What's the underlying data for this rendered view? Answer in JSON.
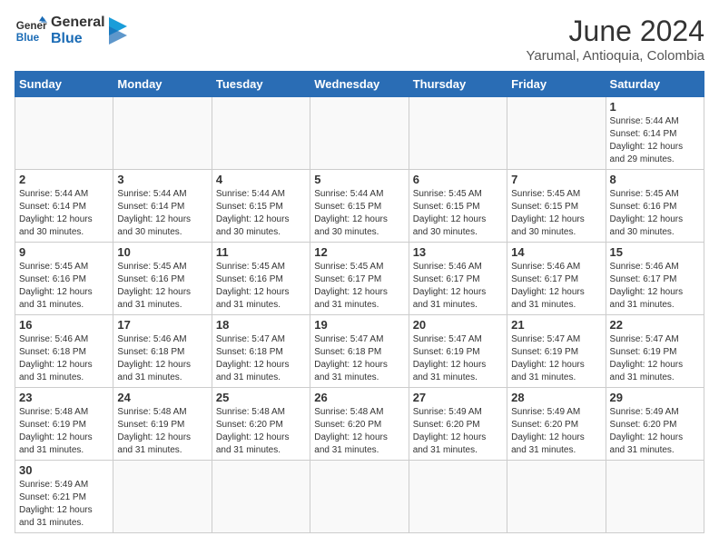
{
  "logo": {
    "text_general": "General",
    "text_blue": "Blue"
  },
  "header": {
    "title": "June 2024",
    "subtitle": "Yarumal, Antioquia, Colombia"
  },
  "weekdays": [
    "Sunday",
    "Monday",
    "Tuesday",
    "Wednesday",
    "Thursday",
    "Friday",
    "Saturday"
  ],
  "weeks": [
    [
      {
        "day": "",
        "info": ""
      },
      {
        "day": "",
        "info": ""
      },
      {
        "day": "",
        "info": ""
      },
      {
        "day": "",
        "info": ""
      },
      {
        "day": "",
        "info": ""
      },
      {
        "day": "",
        "info": ""
      },
      {
        "day": "1",
        "info": "Sunrise: 5:44 AM\nSunset: 6:14 PM\nDaylight: 12 hours\nand 29 minutes."
      }
    ],
    [
      {
        "day": "2",
        "info": "Sunrise: 5:44 AM\nSunset: 6:14 PM\nDaylight: 12 hours\nand 30 minutes."
      },
      {
        "day": "3",
        "info": "Sunrise: 5:44 AM\nSunset: 6:14 PM\nDaylight: 12 hours\nand 30 minutes."
      },
      {
        "day": "4",
        "info": "Sunrise: 5:44 AM\nSunset: 6:15 PM\nDaylight: 12 hours\nand 30 minutes."
      },
      {
        "day": "5",
        "info": "Sunrise: 5:44 AM\nSunset: 6:15 PM\nDaylight: 12 hours\nand 30 minutes."
      },
      {
        "day": "6",
        "info": "Sunrise: 5:45 AM\nSunset: 6:15 PM\nDaylight: 12 hours\nand 30 minutes."
      },
      {
        "day": "7",
        "info": "Sunrise: 5:45 AM\nSunset: 6:15 PM\nDaylight: 12 hours\nand 30 minutes."
      },
      {
        "day": "8",
        "info": "Sunrise: 5:45 AM\nSunset: 6:16 PM\nDaylight: 12 hours\nand 30 minutes."
      }
    ],
    [
      {
        "day": "9",
        "info": "Sunrise: 5:45 AM\nSunset: 6:16 PM\nDaylight: 12 hours\nand 31 minutes."
      },
      {
        "day": "10",
        "info": "Sunrise: 5:45 AM\nSunset: 6:16 PM\nDaylight: 12 hours\nand 31 minutes."
      },
      {
        "day": "11",
        "info": "Sunrise: 5:45 AM\nSunset: 6:16 PM\nDaylight: 12 hours\nand 31 minutes."
      },
      {
        "day": "12",
        "info": "Sunrise: 5:45 AM\nSunset: 6:17 PM\nDaylight: 12 hours\nand 31 minutes."
      },
      {
        "day": "13",
        "info": "Sunrise: 5:46 AM\nSunset: 6:17 PM\nDaylight: 12 hours\nand 31 minutes."
      },
      {
        "day": "14",
        "info": "Sunrise: 5:46 AM\nSunset: 6:17 PM\nDaylight: 12 hours\nand 31 minutes."
      },
      {
        "day": "15",
        "info": "Sunrise: 5:46 AM\nSunset: 6:17 PM\nDaylight: 12 hours\nand 31 minutes."
      }
    ],
    [
      {
        "day": "16",
        "info": "Sunrise: 5:46 AM\nSunset: 6:18 PM\nDaylight: 12 hours\nand 31 minutes."
      },
      {
        "day": "17",
        "info": "Sunrise: 5:46 AM\nSunset: 6:18 PM\nDaylight: 12 hours\nand 31 minutes."
      },
      {
        "day": "18",
        "info": "Sunrise: 5:47 AM\nSunset: 6:18 PM\nDaylight: 12 hours\nand 31 minutes."
      },
      {
        "day": "19",
        "info": "Sunrise: 5:47 AM\nSunset: 6:18 PM\nDaylight: 12 hours\nand 31 minutes."
      },
      {
        "day": "20",
        "info": "Sunrise: 5:47 AM\nSunset: 6:19 PM\nDaylight: 12 hours\nand 31 minutes."
      },
      {
        "day": "21",
        "info": "Sunrise: 5:47 AM\nSunset: 6:19 PM\nDaylight: 12 hours\nand 31 minutes."
      },
      {
        "day": "22",
        "info": "Sunrise: 5:47 AM\nSunset: 6:19 PM\nDaylight: 12 hours\nand 31 minutes."
      }
    ],
    [
      {
        "day": "23",
        "info": "Sunrise: 5:48 AM\nSunset: 6:19 PM\nDaylight: 12 hours\nand 31 minutes."
      },
      {
        "day": "24",
        "info": "Sunrise: 5:48 AM\nSunset: 6:19 PM\nDaylight: 12 hours\nand 31 minutes."
      },
      {
        "day": "25",
        "info": "Sunrise: 5:48 AM\nSunset: 6:20 PM\nDaylight: 12 hours\nand 31 minutes."
      },
      {
        "day": "26",
        "info": "Sunrise: 5:48 AM\nSunset: 6:20 PM\nDaylight: 12 hours\nand 31 minutes."
      },
      {
        "day": "27",
        "info": "Sunrise: 5:49 AM\nSunset: 6:20 PM\nDaylight: 12 hours\nand 31 minutes."
      },
      {
        "day": "28",
        "info": "Sunrise: 5:49 AM\nSunset: 6:20 PM\nDaylight: 12 hours\nand 31 minutes."
      },
      {
        "day": "29",
        "info": "Sunrise: 5:49 AM\nSunset: 6:20 PM\nDaylight: 12 hours\nand 31 minutes."
      }
    ],
    [
      {
        "day": "30",
        "info": "Sunrise: 5:49 AM\nSunset: 6:21 PM\nDaylight: 12 hours\nand 31 minutes."
      },
      {
        "day": "",
        "info": ""
      },
      {
        "day": "",
        "info": ""
      },
      {
        "day": "",
        "info": ""
      },
      {
        "day": "",
        "info": ""
      },
      {
        "day": "",
        "info": ""
      },
      {
        "day": "",
        "info": ""
      }
    ]
  ]
}
